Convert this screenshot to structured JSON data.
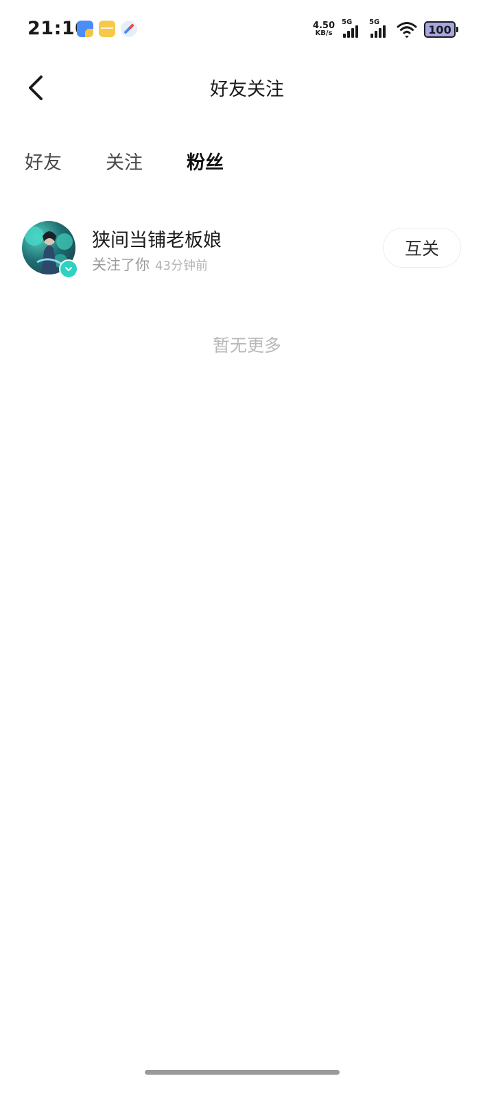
{
  "status_bar": {
    "time": "21:10",
    "net_speed_value": "4.50",
    "net_speed_unit": "KB/s",
    "signal1_label": "5G",
    "signal2_label": "5G",
    "battery_level": "100"
  },
  "nav": {
    "title": "好友关注"
  },
  "tabs": [
    {
      "label": "好友",
      "active": false
    },
    {
      "label": "关注",
      "active": false
    },
    {
      "label": "粉丝",
      "active": true
    }
  ],
  "followers": [
    {
      "name": "狭间当铺老板娘",
      "desc": "关注了你",
      "time": "43分钟前",
      "action_label": "互关",
      "verified": true
    }
  ],
  "footer": {
    "no_more": "暂无更多"
  },
  "colors": {
    "accent": "#2cd3c1",
    "text_primary": "#1a1a1a",
    "text_secondary": "#9a9a9a"
  }
}
